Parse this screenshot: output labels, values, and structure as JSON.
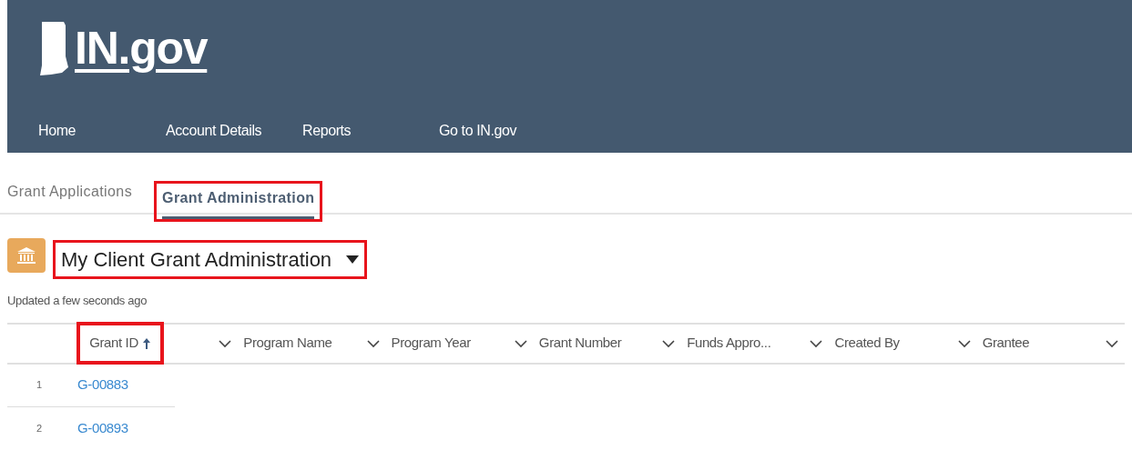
{
  "header": {
    "logo_text": "IN.gov",
    "nav": [
      {
        "label": "Home"
      },
      {
        "label": "Account Details"
      },
      {
        "label": "Reports"
      },
      {
        "label": "Go to IN.gov"
      }
    ]
  },
  "tabs": [
    {
      "label": "Grant Applications",
      "selected": false,
      "highlighted": false
    },
    {
      "label": "Grant Administration",
      "selected": true,
      "highlighted": true
    }
  ],
  "list_view": {
    "title": "My Client Grant Administration",
    "title_highlighted": true,
    "updated": "Updated a few seconds ago"
  },
  "table": {
    "columns": [
      {
        "label": "Grant ID",
        "sorted": true,
        "highlighted": true
      },
      {
        "label": "Program Name",
        "sorted": false,
        "highlighted": false
      },
      {
        "label": "Program Year",
        "sorted": false,
        "highlighted": false
      },
      {
        "label": "Grant Number",
        "sorted": false,
        "highlighted": false
      },
      {
        "label": "Funds Appro...",
        "sorted": false,
        "highlighted": false
      },
      {
        "label": "Created By",
        "sorted": false,
        "highlighted": false
      },
      {
        "label": "Grantee",
        "sorted": false,
        "highlighted": false
      }
    ],
    "rows": [
      {
        "number": "1",
        "grant_id": "G-00883"
      },
      {
        "number": "2",
        "grant_id": "G-00893"
      }
    ]
  }
}
